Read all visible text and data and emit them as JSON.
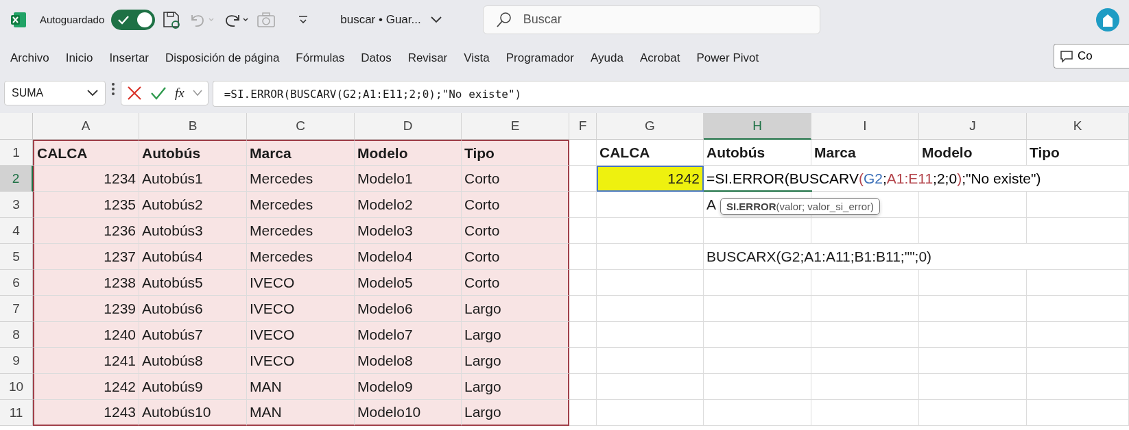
{
  "app": {
    "autosave_label": "Autoguardado",
    "autosave_on": true,
    "document_title": "buscar • Guar...",
    "search_placeholder": "Buscar"
  },
  "ribbon_tabs": [
    "Archivo",
    "Inicio",
    "Insertar",
    "Disposición de página",
    "Fórmulas",
    "Datos",
    "Revisar",
    "Vista",
    "Programador",
    "Ayuda",
    "Acrobat",
    "Power Pivot"
  ],
  "comments_button": "Co",
  "formula_bar": {
    "name_box": "SUMA",
    "function_button": "fx",
    "formula": "=SI.ERROR(BUSCARV(G2;A1:E11;2;0);\"No existe\")"
  },
  "columns": [
    {
      "label": "A",
      "selected": false
    },
    {
      "label": "B",
      "selected": false
    },
    {
      "label": "C",
      "selected": false
    },
    {
      "label": "D",
      "selected": false
    },
    {
      "label": "E",
      "selected": false
    },
    {
      "label": "F",
      "selected": false
    },
    {
      "label": "G",
      "selected": false
    },
    {
      "label": "H",
      "selected": true
    },
    {
      "label": "I",
      "selected": false
    },
    {
      "label": "J",
      "selected": false
    },
    {
      "label": "K",
      "selected": false
    }
  ],
  "rows": [
    {
      "label": "1",
      "selected": false
    },
    {
      "label": "2",
      "selected": true
    },
    {
      "label": "3",
      "selected": false
    },
    {
      "label": "4",
      "selected": false
    },
    {
      "label": "5",
      "selected": false
    },
    {
      "label": "6",
      "selected": false
    },
    {
      "label": "7",
      "selected": false
    },
    {
      "label": "8",
      "selected": false
    },
    {
      "label": "9",
      "selected": false
    },
    {
      "label": "10",
      "selected": false
    },
    {
      "label": "11",
      "selected": false
    }
  ],
  "data_table": {
    "header": [
      "CALCA",
      "Autobús",
      "Marca",
      "Modelo",
      "Tipo"
    ],
    "rows": [
      [
        "1234",
        "Autobús1",
        "Mercedes",
        "Modelo1",
        "Corto"
      ],
      [
        "1235",
        "Autobús2",
        "Mercedes",
        "Modelo2",
        "Corto"
      ],
      [
        "1236",
        "Autobús3",
        "Mercedes",
        "Modelo3",
        "Corto"
      ],
      [
        "1237",
        "Autobús4",
        "Mercedes",
        "Modelo4",
        "Corto"
      ],
      [
        "1238",
        "Autobús5",
        "IVECO",
        "Modelo5",
        "Corto"
      ],
      [
        "1239",
        "Autobús6",
        "IVECO",
        "Modelo6",
        "Largo"
      ],
      [
        "1240",
        "Autobús7",
        "IVECO",
        "Modelo7",
        "Largo"
      ],
      [
        "1241",
        "Autobús8",
        "IVECO",
        "Modelo8",
        "Largo"
      ],
      [
        "1242",
        "Autobús9",
        "MAN",
        "Modelo9",
        "Largo"
      ],
      [
        "1243",
        "Autobús10",
        "MAN",
        "Modelo10",
        "Largo"
      ]
    ]
  },
  "lookup": {
    "header": [
      "CALCA",
      "Autobús",
      "Marca",
      "Modelo",
      "Tipo"
    ],
    "value": "1242",
    "formula_segments": [
      {
        "text": "=SI.ERROR(BUSCARV",
        "color": "#000000"
      },
      {
        "text": "(",
        "color": "#b3434a"
      },
      {
        "text": "G2",
        "color": "#3a6fb8"
      },
      {
        "text": ";",
        "color": "#000000"
      },
      {
        "text": "A1:E11",
        "color": "#b3434a"
      },
      {
        "text": ";2;0",
        "color": "#000000"
      },
      {
        "text": ")",
        "color": "#b3434a"
      },
      {
        "text": ";\"No existe\")",
        "color": "#000000"
      }
    ],
    "h3_text": "A",
    "h5_text": "BUSCARX(G2;A1:A11;B1:B11;\"\";0)"
  },
  "tooltip": "**SI.ERROR**(valor; valor_si_error)"
}
